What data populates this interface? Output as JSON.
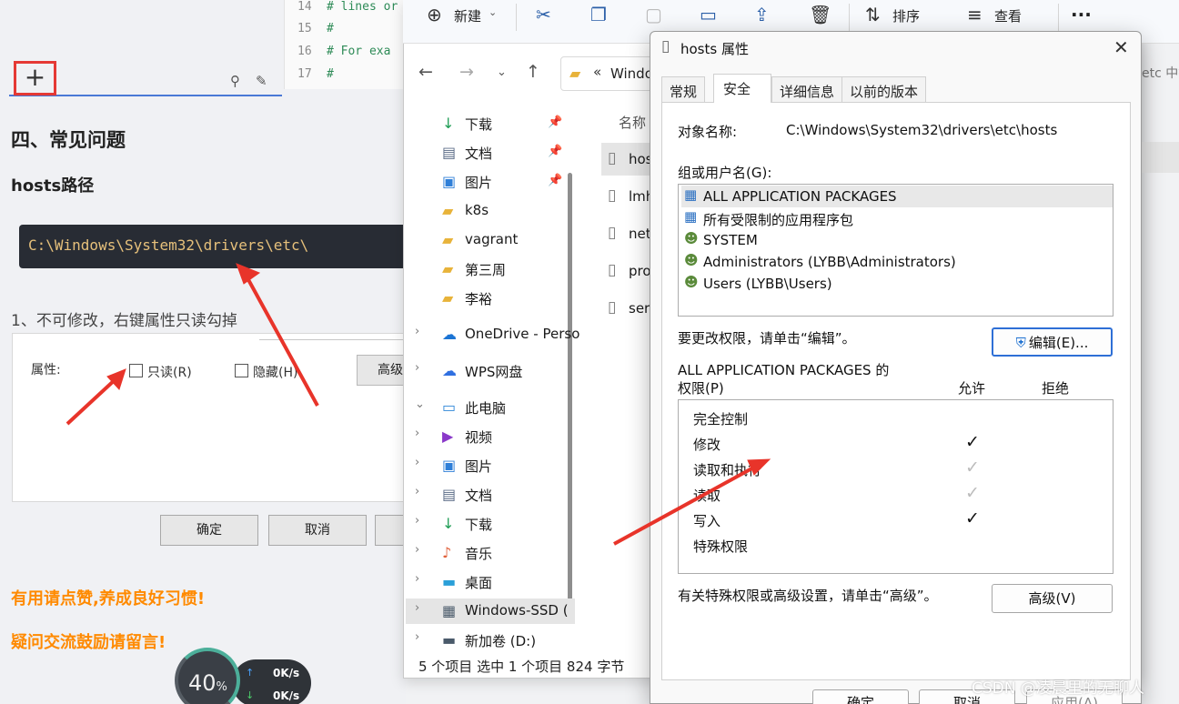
{
  "blog": {
    "code_lines": [
      {
        "num": "14",
        "text": "# lines or"
      },
      {
        "num": "15",
        "text": "#"
      },
      {
        "num": "16",
        "text": "# For exa"
      },
      {
        "num": "17",
        "text": "#"
      }
    ],
    "plus_label": "+",
    "section_title": "四、常见问题",
    "sub_title": "hosts路径",
    "code_path": "C:\\Windows\\System32\\drivers\\etc\\",
    "step_text": "1、不可修改，右键属性只读勾掉",
    "attr_label": "属性:",
    "readonly_label": "只读(R)",
    "hidden_label": "隐藏(H)",
    "advanced_label": "高级",
    "ok_label": "确定",
    "cancel_label": "取消",
    "slogan1": "有用请点赞,养成良好习惯!",
    "slogan2": "疑问交流鼓励请留言!",
    "net": {
      "percent": "40",
      "percent_unit": "%",
      "up": "0K/s",
      "down": "0K/s"
    }
  },
  "explorer": {
    "toolbar": {
      "new_label": "新建",
      "sort_label": "排序",
      "view_label": "查看",
      "more_label": "···"
    },
    "address": "Windo",
    "address_right": "etc 中搜",
    "column_name": "名称",
    "nav_items": [
      {
        "label": "下载",
        "icon": "↓",
        "color": "#1f9d55",
        "pinned": true,
        "chev": false
      },
      {
        "label": "文档",
        "icon": "▤",
        "color": "#5a6b86",
        "pinned": true,
        "chev": false
      },
      {
        "label": "图片",
        "icon": "▣",
        "color": "#2f7fd8",
        "pinned": true,
        "chev": false
      },
      {
        "label": "k8s",
        "icon": "▰",
        "color": "#e8b33a",
        "pinned": false,
        "chev": false
      },
      {
        "label": "vagrant",
        "icon": "▰",
        "color": "#e8b33a",
        "pinned": false,
        "chev": false
      },
      {
        "label": "第三周",
        "icon": "▰",
        "color": "#e8b33a",
        "pinned": false,
        "chev": false
      },
      {
        "label": "李裕",
        "icon": "▰",
        "color": "#e8b33a",
        "pinned": false,
        "chev": false
      },
      {
        "label": "OneDrive - Perso",
        "icon": "☁",
        "color": "#1b74d4",
        "pinned": false,
        "chev": true
      },
      {
        "label": "WPS网盘",
        "icon": "☁",
        "color": "#2f6fe0",
        "pinned": false,
        "chev": true
      },
      {
        "label": "此电脑",
        "icon": "▭",
        "color": "#2f86d8",
        "pinned": false,
        "chev": true
      },
      {
        "label": "视频",
        "icon": "▶",
        "color": "#8a39c9",
        "pinned": false,
        "chev": true
      },
      {
        "label": "图片",
        "icon": "▣",
        "color": "#2f7fd8",
        "pinned": false,
        "chev": true
      },
      {
        "label": "文档",
        "icon": "▤",
        "color": "#5a6b86",
        "pinned": false,
        "chev": true
      },
      {
        "label": "下载",
        "icon": "↓",
        "color": "#1f9d55",
        "pinned": false,
        "chev": true
      },
      {
        "label": "音乐",
        "icon": "♪",
        "color": "#e0603a",
        "pinned": false,
        "chev": true
      },
      {
        "label": "桌面",
        "icon": "▬",
        "color": "#2a9fd8",
        "pinned": false,
        "chev": true
      },
      {
        "label": "Windows-SSD (",
        "icon": "▦",
        "color": "#4a5a6a",
        "pinned": false,
        "chev": true
      },
      {
        "label": "新加卷 (D:)",
        "icon": "▬",
        "color": "#4a5a6a",
        "pinned": false,
        "chev": true
      }
    ],
    "files": [
      "hos",
      "lmh",
      "net",
      "pro",
      "ser"
    ],
    "status": "5 个项目    选中 1 个项目  824 字节"
  },
  "dialog": {
    "title": "hosts 属性",
    "tabs": [
      "常规",
      "安全",
      "详细信息",
      "以前的版本"
    ],
    "object_label": "对象名称:",
    "object_value": "C:\\Windows\\System32\\drivers\\etc\\hosts",
    "groups_label": "组或用户名(G):",
    "users": [
      "ALL APPLICATION PACKAGES",
      "所有受限制的应用程序包",
      "SYSTEM",
      "Administrators (LYBB\\Administrators)",
      "Users (LYBB\\Users)"
    ],
    "change_hint": "要更改权限，请单击“编辑”。",
    "edit_label": "编辑(E)...",
    "perm_title": "ALL APPLICATION PACKAGES 的",
    "perm_sub": "权限(P)",
    "allow_label": "允许",
    "deny_label": "拒绝",
    "permissions": [
      {
        "name": "完全控制",
        "allow": ""
      },
      {
        "name": "修改",
        "allow": "on"
      },
      {
        "name": "读取和执行",
        "allow": "dim"
      },
      {
        "name": "读取",
        "allow": "dim"
      },
      {
        "name": "写入",
        "allow": "on"
      },
      {
        "name": "特殊权限",
        "allow": ""
      }
    ],
    "special_hint": "有关特殊权限或高级设置，请单击“高级”。",
    "advanced_label": "高级(V)",
    "footer": {
      "ok": "确定",
      "cancel": "取消",
      "apply": "应用(A)"
    }
  },
  "watermark": "CSDN @凌晨里的无聊人",
  "colors": {
    "arrow": "#e8342a",
    "accent": "#2e6fd6",
    "orange": "#ff8a00"
  }
}
